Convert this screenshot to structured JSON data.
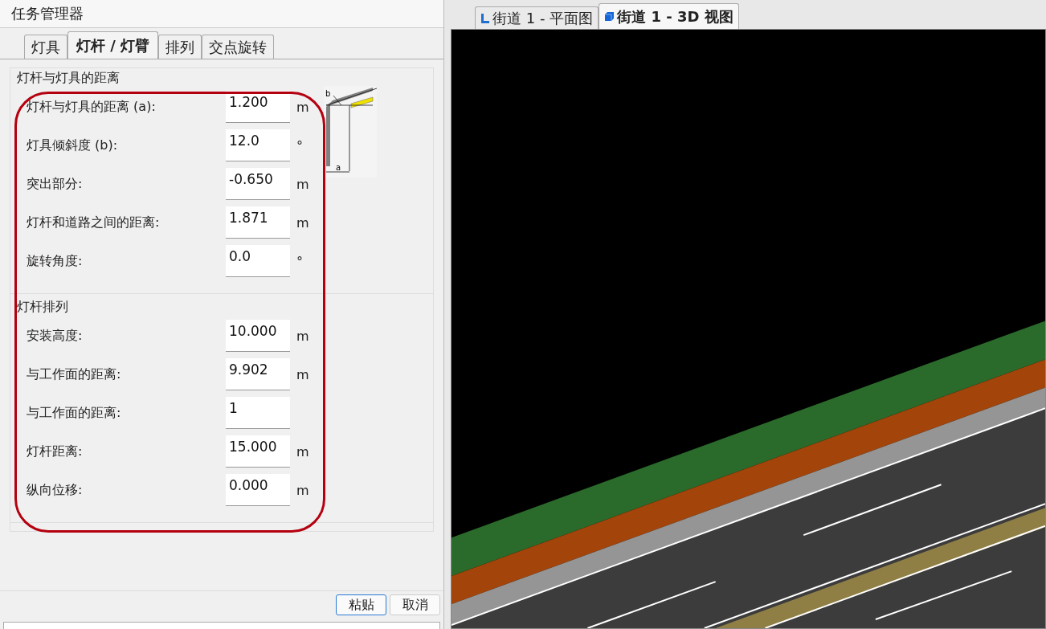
{
  "window": {
    "title": "任务管理器"
  },
  "tabs": [
    {
      "label": "灯具",
      "selected": false
    },
    {
      "label": "灯杆 / 灯臂",
      "selected": true
    },
    {
      "label": "排列",
      "selected": false
    },
    {
      "label": "交点旋转",
      "selected": false
    }
  ],
  "groups": [
    {
      "title": "灯杆与灯具的距离",
      "rows": [
        {
          "label": "灯杆与灯具的距离 (a):",
          "value": "1.200",
          "unit": "m"
        },
        {
          "label": "灯具倾斜度 (b):",
          "value": "12.0",
          "unit": "°"
        },
        {
          "label": "突出部分:",
          "value": "-0.650",
          "unit": "m"
        },
        {
          "label": "灯杆和道路之间的距离:",
          "value": "1.871",
          "unit": "m"
        },
        {
          "label": "旋转角度:",
          "value": "0.0",
          "unit": "°"
        }
      ]
    },
    {
      "title": "灯杆排列",
      "rows": [
        {
          "label": "安装高度:",
          "value": "10.000",
          "unit": "m"
        },
        {
          "label": "与工作面的距离:",
          "value": "9.902",
          "unit": "m"
        },
        {
          "label": "与工作面的距离:",
          "value": "1"
        },
        {
          "label": "灯杆距离:",
          "value": "15.000",
          "unit": "m"
        },
        {
          "label": "纵向位移:",
          "value": "0.000",
          "unit": "m"
        }
      ]
    }
  ],
  "diagram": {
    "label_a": "a",
    "label_b": "b"
  },
  "buttons": [
    "粘贴",
    "取消"
  ],
  "view_tabs": [
    {
      "label": "街道 1 - 平面图",
      "kind": "plan",
      "selected": false
    },
    {
      "label": "街道 1 - 3D 视图",
      "kind": "perspective",
      "selected": true
    }
  ]
}
